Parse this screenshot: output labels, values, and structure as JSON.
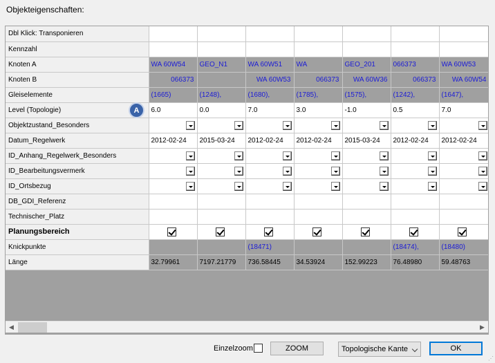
{
  "window": {
    "title": "Objekteigenschaften:"
  },
  "marker": {
    "label": "A"
  },
  "rows": [
    {
      "label": "Dbl Klick: Transponieren",
      "type": "header",
      "cells": [
        "",
        "",
        "",
        "",
        "",
        "",
        ""
      ]
    },
    {
      "label": "Kennzahl",
      "type": "text",
      "cells": [
        "",
        "",
        "",
        "",
        "",
        "",
        ""
      ]
    },
    {
      "label": "Knoten A",
      "type": "blue_left",
      "cells": [
        "WA 60W54",
        "GEO_N1",
        "WA 60W51",
        "WA",
        "GEO_201",
        "066373",
        "WA 60W53"
      ]
    },
    {
      "label": "Knoten B",
      "type": "blue_right",
      "cells": [
        "066373",
        "",
        "WA 60W53",
        "066373",
        "WA 60W36",
        "066373",
        "WA 60W54"
      ]
    },
    {
      "label": "Gleiselemente",
      "type": "blue_left",
      "cells": [
        "(1665)",
        "(1248),",
        "(1680),",
        "(1785),",
        "(1575),",
        "(1242),",
        "(1647),"
      ]
    },
    {
      "label": "Level (Topologie)",
      "type": "text",
      "cells": [
        "6.0",
        "0.0",
        "7.0",
        "3.0",
        "-1.0",
        "0.5",
        "7.0"
      ]
    },
    {
      "label": "Objektzustand_Besonders",
      "type": "dropdown",
      "cells": [
        "",
        "",
        "",
        "",
        "",
        "",
        ""
      ]
    },
    {
      "label": "Datum_Regelwerk",
      "type": "text",
      "cells": [
        "2012-02-24",
        "2015-03-24",
        "2012-02-24",
        "2012-02-24",
        "2015-03-24",
        "2012-02-24",
        "2012-02-24"
      ]
    },
    {
      "label": "ID_Anhang_Regelwerk_Besonders",
      "type": "dropdown",
      "cells": [
        "",
        "",
        "",
        "",
        "",
        "",
        ""
      ]
    },
    {
      "label": "ID_Bearbeitungsvermerk",
      "type": "dropdown",
      "cells": [
        "",
        "",
        "",
        "",
        "",
        "",
        ""
      ]
    },
    {
      "label": "ID_Ortsbezug",
      "type": "dropdown",
      "cells": [
        "",
        "",
        "",
        "",
        "",
        "",
        ""
      ]
    },
    {
      "label": "DB_GDI_Referenz",
      "type": "text",
      "cells": [
        "",
        "",
        "",
        "",
        "",
        "",
        ""
      ]
    },
    {
      "label": "Technischer_Platz",
      "type": "text",
      "cells": [
        "",
        "",
        "",
        "",
        "",
        "",
        ""
      ]
    },
    {
      "label": "Planungsbereich",
      "type": "checkbox",
      "bold": true,
      "cells": [
        true,
        true,
        true,
        true,
        true,
        true,
        true
      ]
    },
    {
      "label": "Knickpunkte",
      "type": "blue_left",
      "cells": [
        "",
        "",
        "(18471)",
        "",
        "",
        "(18474),",
        "(18480)"
      ]
    },
    {
      "label": "Länge",
      "type": "gray_text",
      "cells": [
        "32.79961",
        "7197.21779",
        "736.58445",
        "34.53924",
        "152.99223",
        "76.48980",
        "59.48763"
      ]
    }
  ],
  "footer": {
    "einzelzoom_label": "Einzelzoom",
    "zoom_button": "ZOOM",
    "mode_select": "Topologische Kante",
    "ok_button": "OK"
  },
  "scrollbar": {
    "left_arrow": "◀",
    "right_arrow": "▶"
  }
}
